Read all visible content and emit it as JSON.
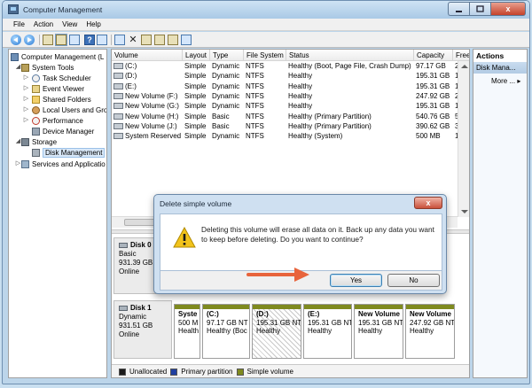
{
  "window": {
    "title": "Computer Management",
    "close_glyph": "x"
  },
  "menu": [
    "File",
    "Action",
    "View",
    "Help"
  ],
  "toolbar": {
    "help_glyph": "?",
    "delete_glyph": "✕"
  },
  "tree": {
    "root": "Computer Management (L",
    "system_tools": "System Tools",
    "task_scheduler": "Task Scheduler",
    "event_viewer": "Event Viewer",
    "shared_folders": "Shared Folders",
    "local_users": "Local Users and Gro",
    "performance": "Performance",
    "device_manager": "Device Manager",
    "storage": "Storage",
    "disk_management": "Disk Management",
    "services": "Services and Applicatio",
    "expander_open": "◢",
    "expander_closed": "▷"
  },
  "volume_table": {
    "columns": [
      "Volume",
      "Layout",
      "Type",
      "File System",
      "Status",
      "Capacity",
      "Free"
    ],
    "rows": [
      [
        "(C:)",
        "Simple",
        "Dynamic",
        "NTFS",
        "Healthy (Boot, Page File, Crash Dump)",
        "97.17 GB",
        "25.4"
      ],
      [
        "(D:)",
        "Simple",
        "Dynamic",
        "NTFS",
        "Healthy",
        "195.31 GB",
        "189."
      ],
      [
        "(E:)",
        "Simple",
        "Dynamic",
        "NTFS",
        "Healthy",
        "195.31 GB",
        "195."
      ],
      [
        "New Volume (F:)",
        "Simple",
        "Dynamic",
        "NTFS",
        "Healthy",
        "247.92 GB",
        "247."
      ],
      [
        "New Volume (G:)",
        "Simple",
        "Dynamic",
        "NTFS",
        "Healthy",
        "195.31 GB",
        "195."
      ],
      [
        "New Volume (H:)",
        "Simple",
        "Basic",
        "NTFS",
        "Healthy (Primary Partition)",
        "540.76 GB",
        "540."
      ],
      [
        "New Volume (J:)",
        "Simple",
        "Basic",
        "NTFS",
        "Healthy (Primary Partition)",
        "390.62 GB",
        "390."
      ],
      [
        "System Reserved",
        "Simple",
        "Dynamic",
        "NTFS",
        "Healthy (System)",
        "500 MB",
        "165"
      ]
    ]
  },
  "disks": [
    {
      "name": "Disk 0",
      "type": "Basic",
      "size": "931.39 GB",
      "status": "Online"
    },
    {
      "name": "Disk 1",
      "type": "Dynamic",
      "size": "931.51 GB",
      "status": "Online"
    }
  ],
  "disk1_partitions": [
    {
      "name": "Syste",
      "line1": "500 M",
      "line2": "Health"
    },
    {
      "name": "(C:)",
      "line1": "97.17 GB NT",
      "line2": "Healthy (Boc"
    },
    {
      "name": "(D:)",
      "line1": "195.31 GB NT",
      "line2": "Healthy"
    },
    {
      "name": "(E:)",
      "line1": "195.31 GB NT",
      "line2": "Healthy"
    },
    {
      "name": "New Volume",
      "line1": "195.31 GB NT",
      "line2": "Healthy"
    },
    {
      "name": "New Volume",
      "line1": "247.92 GB NT",
      "line2": "Healthy"
    }
  ],
  "legend": [
    {
      "label": "Unallocated",
      "color": "#1a1a1a"
    },
    {
      "label": "Primary partition",
      "color": "#1f3fa0"
    },
    {
      "label": "Simple volume",
      "color": "#7f8a1f"
    }
  ],
  "actions": {
    "title": "Actions",
    "section": "Disk Mana...",
    "more": "More ..."
  },
  "dialog": {
    "title": "Delete simple volume",
    "message": "Deleting this volume will erase all data on it. Back up any data you want to keep before deleting. Do you want to continue?",
    "yes": "Yes",
    "no": "No",
    "close_glyph": "x"
  },
  "colors": {
    "annotation_arrow": "#e8643c",
    "warning": "#f2c31b",
    "simple_volume": "#7f8a1f"
  }
}
